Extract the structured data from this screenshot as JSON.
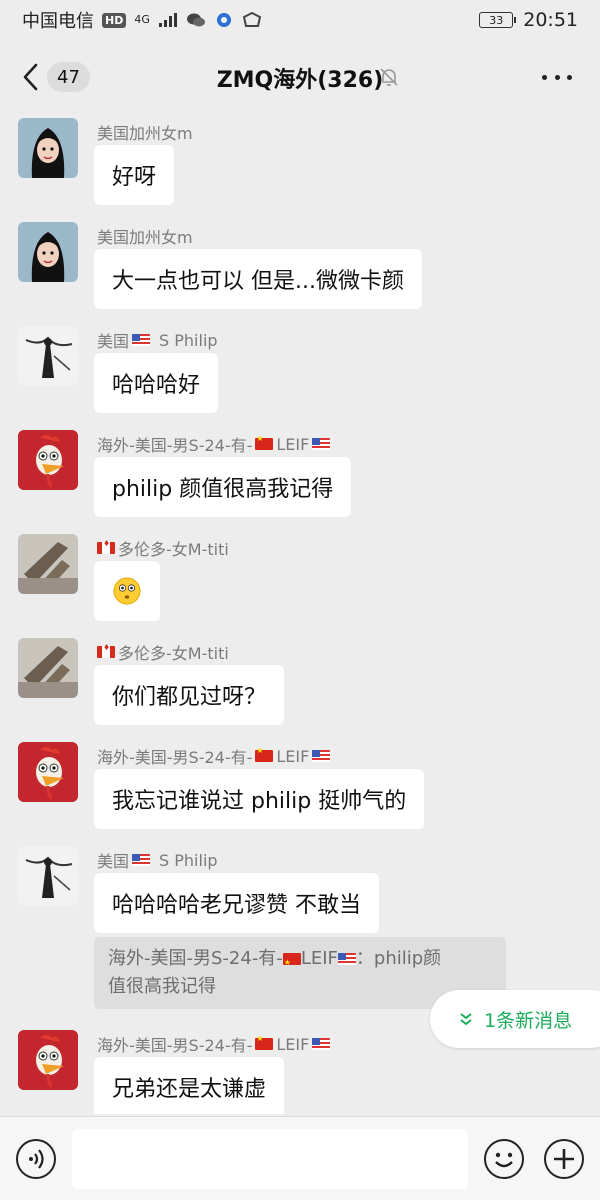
{
  "status_bar": {
    "carrier": "中国电信",
    "hd_badge": "HD",
    "network": "4G",
    "battery": "33",
    "time": "20:51"
  },
  "header": {
    "unread_count": "47",
    "title": "ZMQ海外(326)"
  },
  "messages": [
    {
      "sender": "美国加州女m",
      "flag_prefix": "",
      "flag_suffix": "",
      "text": "好呀",
      "avatar": "girl-cartoon"
    },
    {
      "sender": "美国加州女m",
      "flag_prefix": "",
      "flag_suffix": "",
      "text": "大一点也可以 但是...微微卡颜",
      "avatar": "girl-cartoon"
    },
    {
      "sender_a": "美国",
      "sender_b": "S Philip",
      "text": "哈哈哈好",
      "avatar": "ink-figure"
    },
    {
      "sender_a": "海外-美国-男S-24-有-",
      "sender_b": "LEIF",
      "text": "philip 颜值很高我记得",
      "avatar": "rooster"
    },
    {
      "sender": "多伦多-女M-titi",
      "text": "",
      "emoji": "flushed-face",
      "avatar": "cat-photo"
    },
    {
      "sender": "多伦多-女M-titi",
      "text": "你们都见过呀？",
      "avatar": "cat-photo"
    },
    {
      "sender_a": "海外-美国-男S-24-有-",
      "sender_b": "LEIF",
      "text": "我忘记谁说过 philip 挺帅气的",
      "avatar": "rooster"
    },
    {
      "sender_a": "美国",
      "sender_b": "S Philip",
      "text": "哈哈哈哈老兄谬赞 不敢当",
      "avatar": "ink-figure"
    },
    {
      "sender_a": "海外-美国-男S-24-有-",
      "sender_b": "LEIF",
      "text": "兄弟还是太谦虚",
      "avatar": "rooster"
    }
  ],
  "quote": {
    "line1_a": "海外-美国-男S-24-有-",
    "line1_b": "LEIF",
    "line1_c": "：philip颜",
    "line2": "值很高我记得"
  },
  "new_message_pill": "1条新消息",
  "colors": {
    "background": "#ededed",
    "bubble": "#ffffff",
    "accent_green": "#1aad5a",
    "sender_gray": "#7b7b7b"
  }
}
